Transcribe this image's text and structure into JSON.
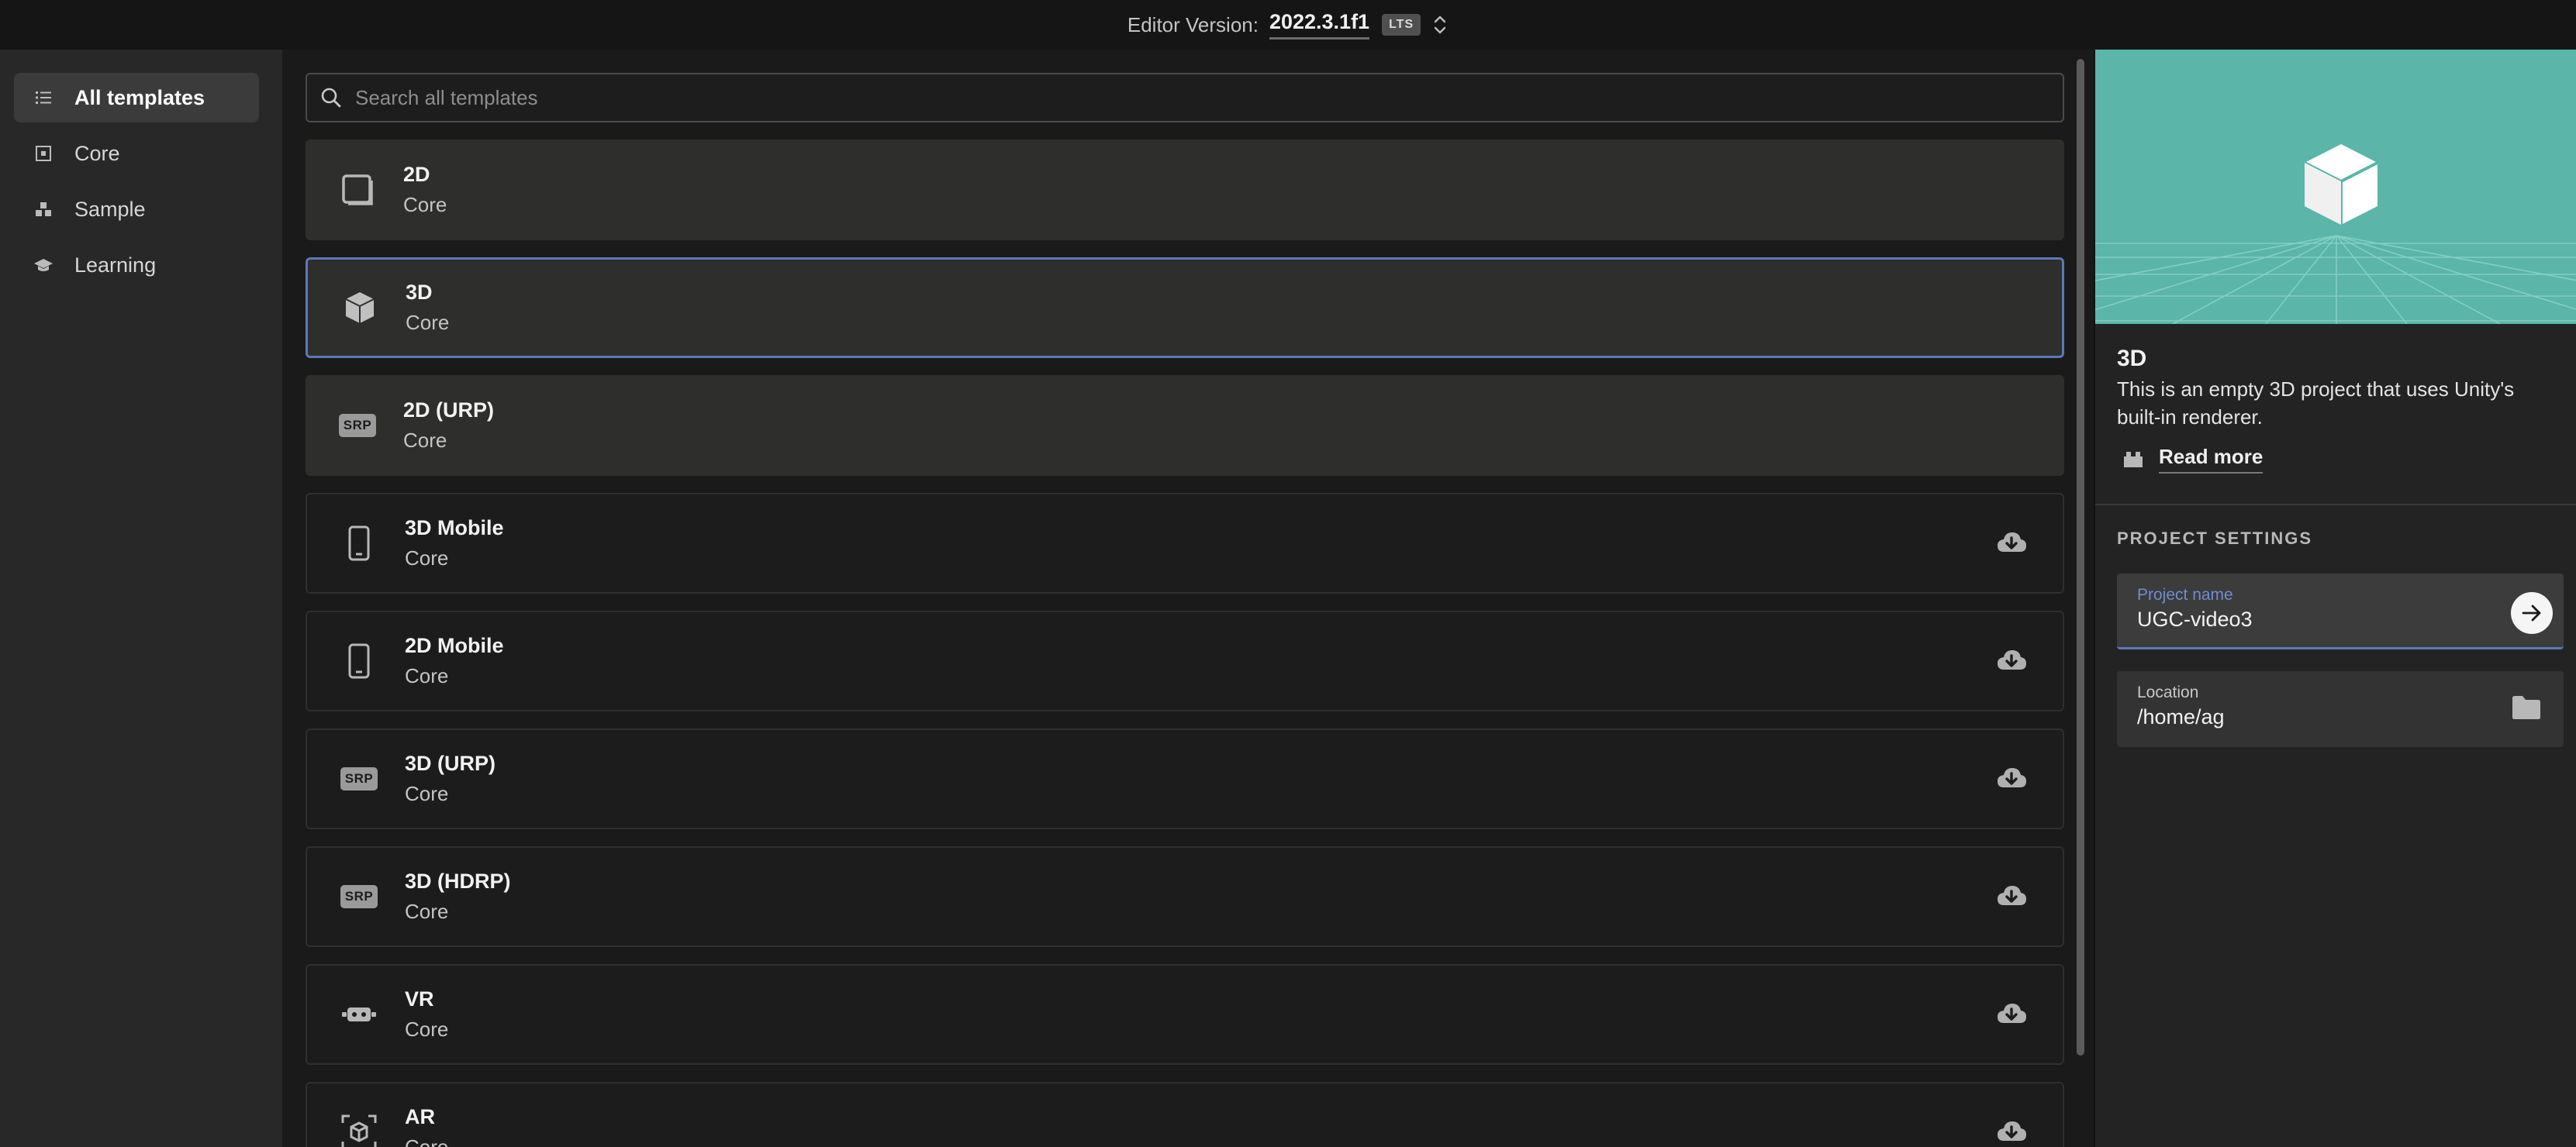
{
  "topbar": {
    "editor_label": "Editor Version:",
    "editor_version": "2022.3.1f1",
    "badge": "LTS"
  },
  "sidebar": {
    "items": [
      {
        "label": "All templates",
        "icon": "list-icon",
        "active": true
      },
      {
        "label": "Core",
        "icon": "core-icon"
      },
      {
        "label": "Sample",
        "icon": "sample-icon"
      },
      {
        "label": "Learning",
        "icon": "learning-icon"
      }
    ]
  },
  "search": {
    "placeholder": "Search all templates"
  },
  "templates": [
    {
      "name": "2D",
      "category": "Core",
      "icon": "2d-square-icon",
      "state": "installed"
    },
    {
      "name": "3D",
      "category": "Core",
      "icon": "cube-icon",
      "state": "selected"
    },
    {
      "name": "2D (URP)",
      "category": "Core",
      "icon": "srp-badge-icon",
      "state": "installed",
      "badge": "SRP"
    },
    {
      "name": "3D Mobile",
      "category": "Core",
      "icon": "mobile-phone-icon",
      "state": "download"
    },
    {
      "name": "2D Mobile",
      "category": "Core",
      "icon": "mobile-phone-icon",
      "state": "download"
    },
    {
      "name": "3D (URP)",
      "category": "Core",
      "icon": "srp-badge-icon",
      "state": "download",
      "badge": "SRP"
    },
    {
      "name": "3D (HDRP)",
      "category": "Core",
      "icon": "srp-badge-icon",
      "state": "download",
      "badge": "SRP"
    },
    {
      "name": "VR",
      "category": "Core",
      "icon": "vr-headset-icon",
      "state": "download"
    },
    {
      "name": "AR",
      "category": "Core",
      "icon": "ar-cube-icon",
      "state": "download"
    }
  ],
  "details": {
    "title": "3D",
    "description": "This is an empty 3D project that uses Unity's built-in renderer.",
    "read_more": "Read more",
    "settings_heading": "PROJECT SETTINGS",
    "project_name_label": "Project name",
    "project_name_value": "UGC-video3",
    "location_label": "Location",
    "location_value": "/home/ag"
  },
  "colors": {
    "accent": "#5b78b8",
    "preview_bg": "#5bb5a8",
    "background": "#1a1a1a"
  }
}
